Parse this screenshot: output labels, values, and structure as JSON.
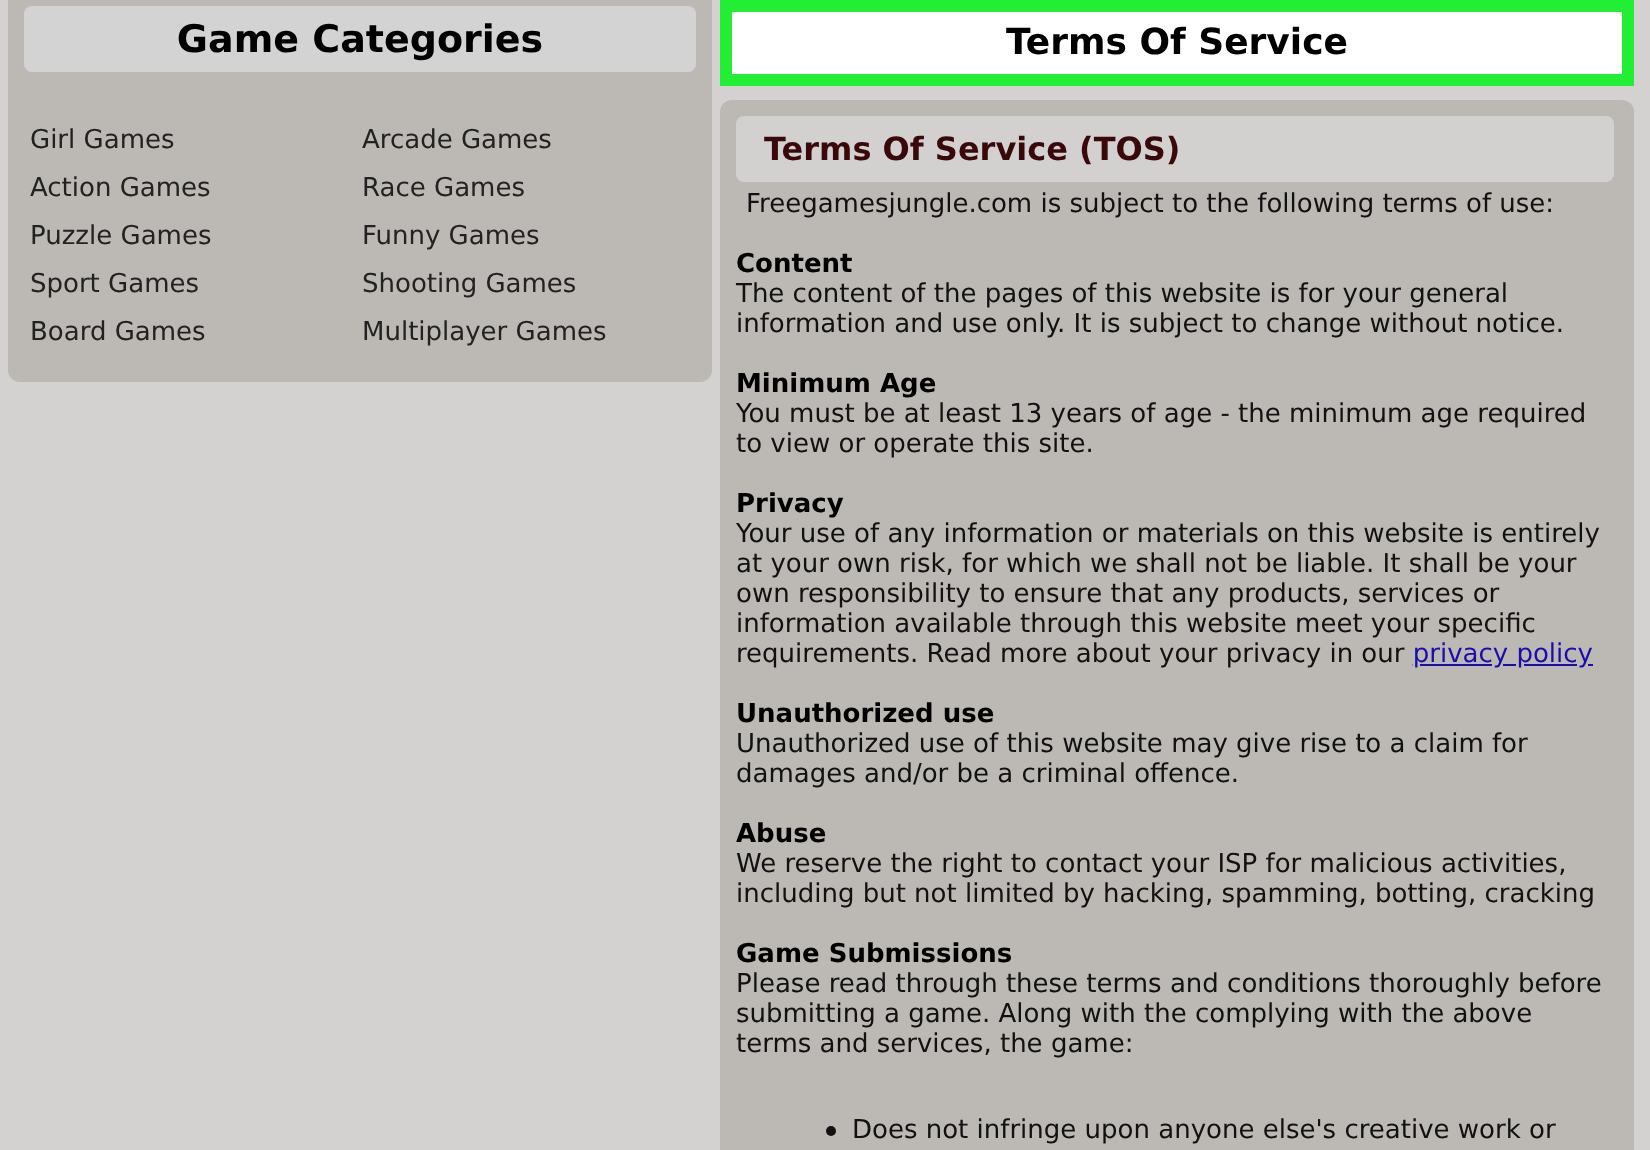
{
  "categories": {
    "title": "Game Categories",
    "items": [
      {
        "label": "Girl Games"
      },
      {
        "label": "Arcade Games"
      },
      {
        "label": "Action Games"
      },
      {
        "label": "Race Games"
      },
      {
        "label": "Puzzle Games"
      },
      {
        "label": "Funny Games"
      },
      {
        "label": "Sport Games"
      },
      {
        "label": "Shooting Games"
      },
      {
        "label": "Board Games"
      },
      {
        "label": "Multiplayer Games"
      }
    ]
  },
  "page_title": "Terms Of Service",
  "tos": {
    "heading": "Terms Of Service (TOS)",
    "intro": "Freegamesjungle.com is subject to the following terms of use:",
    "sections": [
      {
        "title": "Content",
        "body": "The content of the pages of this website is for your general information and use only. It is subject to change without notice."
      },
      {
        "title": "Minimum Age",
        "body": "You must be at least 13 years of age - the minimum age required to view or operate this site."
      },
      {
        "title": "Privacy",
        "body": "Your use of any information or materials on this website is entirely at your own risk, for which we shall not be liable. It shall be your own responsibility to ensure that any products, services or information available through this website meet your specific requirements. Read more about your privacy in our",
        "link": "privacy policy"
      },
      {
        "title": "Unauthorized use",
        "body": "Unauthorized use of this website may give rise to a claim for damages and/or be a criminal offence."
      },
      {
        "title": "Abuse",
        "body": "We reserve the right to contact your ISP for malicious activities, including but not limited by hacking, spamming, botting, cracking"
      },
      {
        "title": "Game Submissions",
        "body": "Please read through these terms and conditions thoroughly before submitting a game. Along with the complying with the above terms and services, the game:"
      }
    ],
    "bullets": [
      "Does not infringe upon anyone else's creative work or"
    ]
  }
}
